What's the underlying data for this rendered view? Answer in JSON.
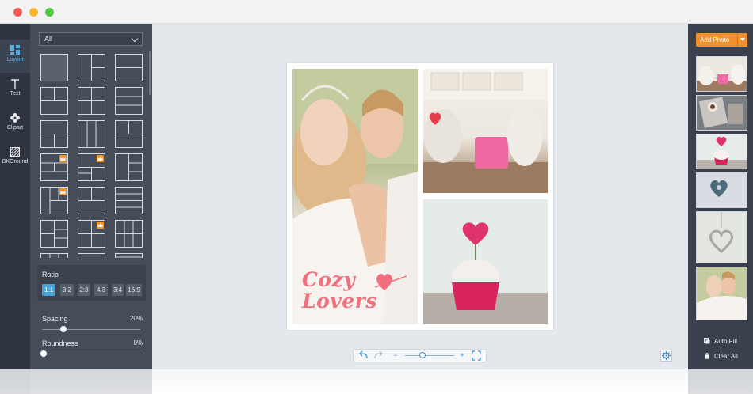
{
  "window": {
    "traffic_lights": [
      "close",
      "minimize",
      "zoom"
    ]
  },
  "toolbar": {
    "tools": [
      {
        "label": "Layout",
        "icon": "layout-icon",
        "active": true
      },
      {
        "label": "Text",
        "icon": "text-icon",
        "active": false
      },
      {
        "label": "Clipart",
        "icon": "clipart-icon",
        "active": false
      },
      {
        "label": "BKGround",
        "icon": "background-icon",
        "active": false
      }
    ]
  },
  "layout_panel": {
    "filter": {
      "selected": "All"
    },
    "premium_icon": "crown-icon",
    "ratio": {
      "title": "Ratio",
      "options": [
        "1:1",
        "3:2",
        "2:3",
        "4:3",
        "3:4",
        "16:9"
      ],
      "selected": "1:1"
    },
    "spacing": {
      "label": "Spacing",
      "value_text": "20%",
      "value": 20
    },
    "roundness": {
      "label": "Roundness",
      "value_text": "0%",
      "value": 0
    }
  },
  "canvas": {
    "overlay_text": {
      "line1": "Cozy",
      "line2": "Lovers",
      "color": "#f26f7e"
    },
    "photos": [
      "couple-embrace",
      "kitchen-jars",
      "heart-cupcake"
    ]
  },
  "zoom_bar": {
    "undo": "undo-icon",
    "redo": "redo-icon",
    "minus": "−",
    "plus": "+",
    "fullscreen": "fullscreen-icon",
    "zoom_level": 0.35
  },
  "right_panel": {
    "add_photo_label": "Add Photo",
    "thumbnails": [
      "kitchen-jars",
      "coffee-table",
      "heart-cupcake",
      "heart-cookie",
      "heart-ornament",
      "couple-embrace"
    ],
    "actions": [
      {
        "label": "Auto Fill",
        "icon": "auto-fill-icon"
      },
      {
        "label": "Clear All",
        "icon": "trash-icon"
      }
    ]
  },
  "colors": {
    "accent": "#49a0d6",
    "orange": "#f3902a",
    "panel_dark": "#2f3540",
    "panel": "#454d59",
    "canvas_bg": "#e4e8ec"
  }
}
